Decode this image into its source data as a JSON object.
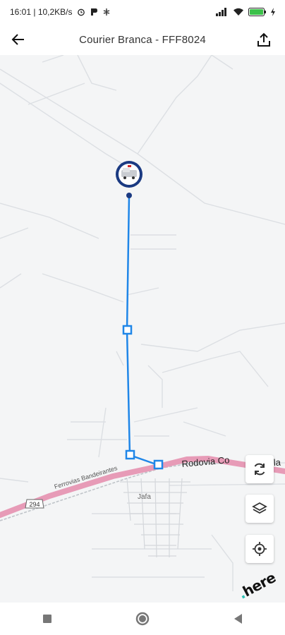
{
  "status_bar": {
    "time_speed": "16:01 | 10,2KB/s"
  },
  "app_bar": {
    "title": "Courier Branca - FFF8024"
  },
  "map": {
    "road_label": "Rodovia Co",
    "road_label_tail": "la",
    "rail_label": "Ferrovias Bandeirantes",
    "town_label": "Jafa",
    "highway_shield": "294",
    "brand": "here",
    "route_color": "#1f86e8",
    "highway_color": "#e79bb7"
  },
  "controls": {
    "refresh_icon": "refresh-icon",
    "layers_icon": "layers-icon",
    "locate_icon": "locate-icon"
  },
  "nav": {
    "recents_icon": "square-icon",
    "home_icon": "circle-icon",
    "back_icon": "triangle-icon"
  }
}
